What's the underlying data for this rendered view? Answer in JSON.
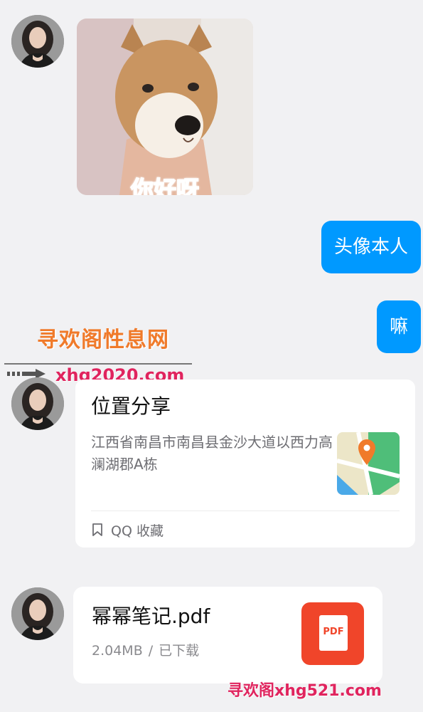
{
  "messages": {
    "sticker": {
      "caption": "你好呀",
      "icon": "shiba-dog-sticker"
    },
    "outgoing_1": "头像本人",
    "outgoing_2": "嘛",
    "location": {
      "title": "位置分享",
      "address": "江西省南昌市南昌县金沙大道以西力高澜湖郡A栋",
      "footer": "QQ 收藏",
      "icon": "map-pin-icon"
    },
    "file": {
      "name": "幂幂笔记.pdf",
      "size": "2.04MB",
      "separator": "/",
      "status": "已下载",
      "type_label": "PDF"
    }
  },
  "watermark": {
    "site_name": "寻欢阁性息网",
    "url": "xhg2020.com",
    "bottom": "寻欢阁xhg521.com"
  },
  "colors": {
    "outgoing_bubble": "#0099ff",
    "background": "#f1f1f3",
    "pdf_icon": "#f0452a"
  }
}
